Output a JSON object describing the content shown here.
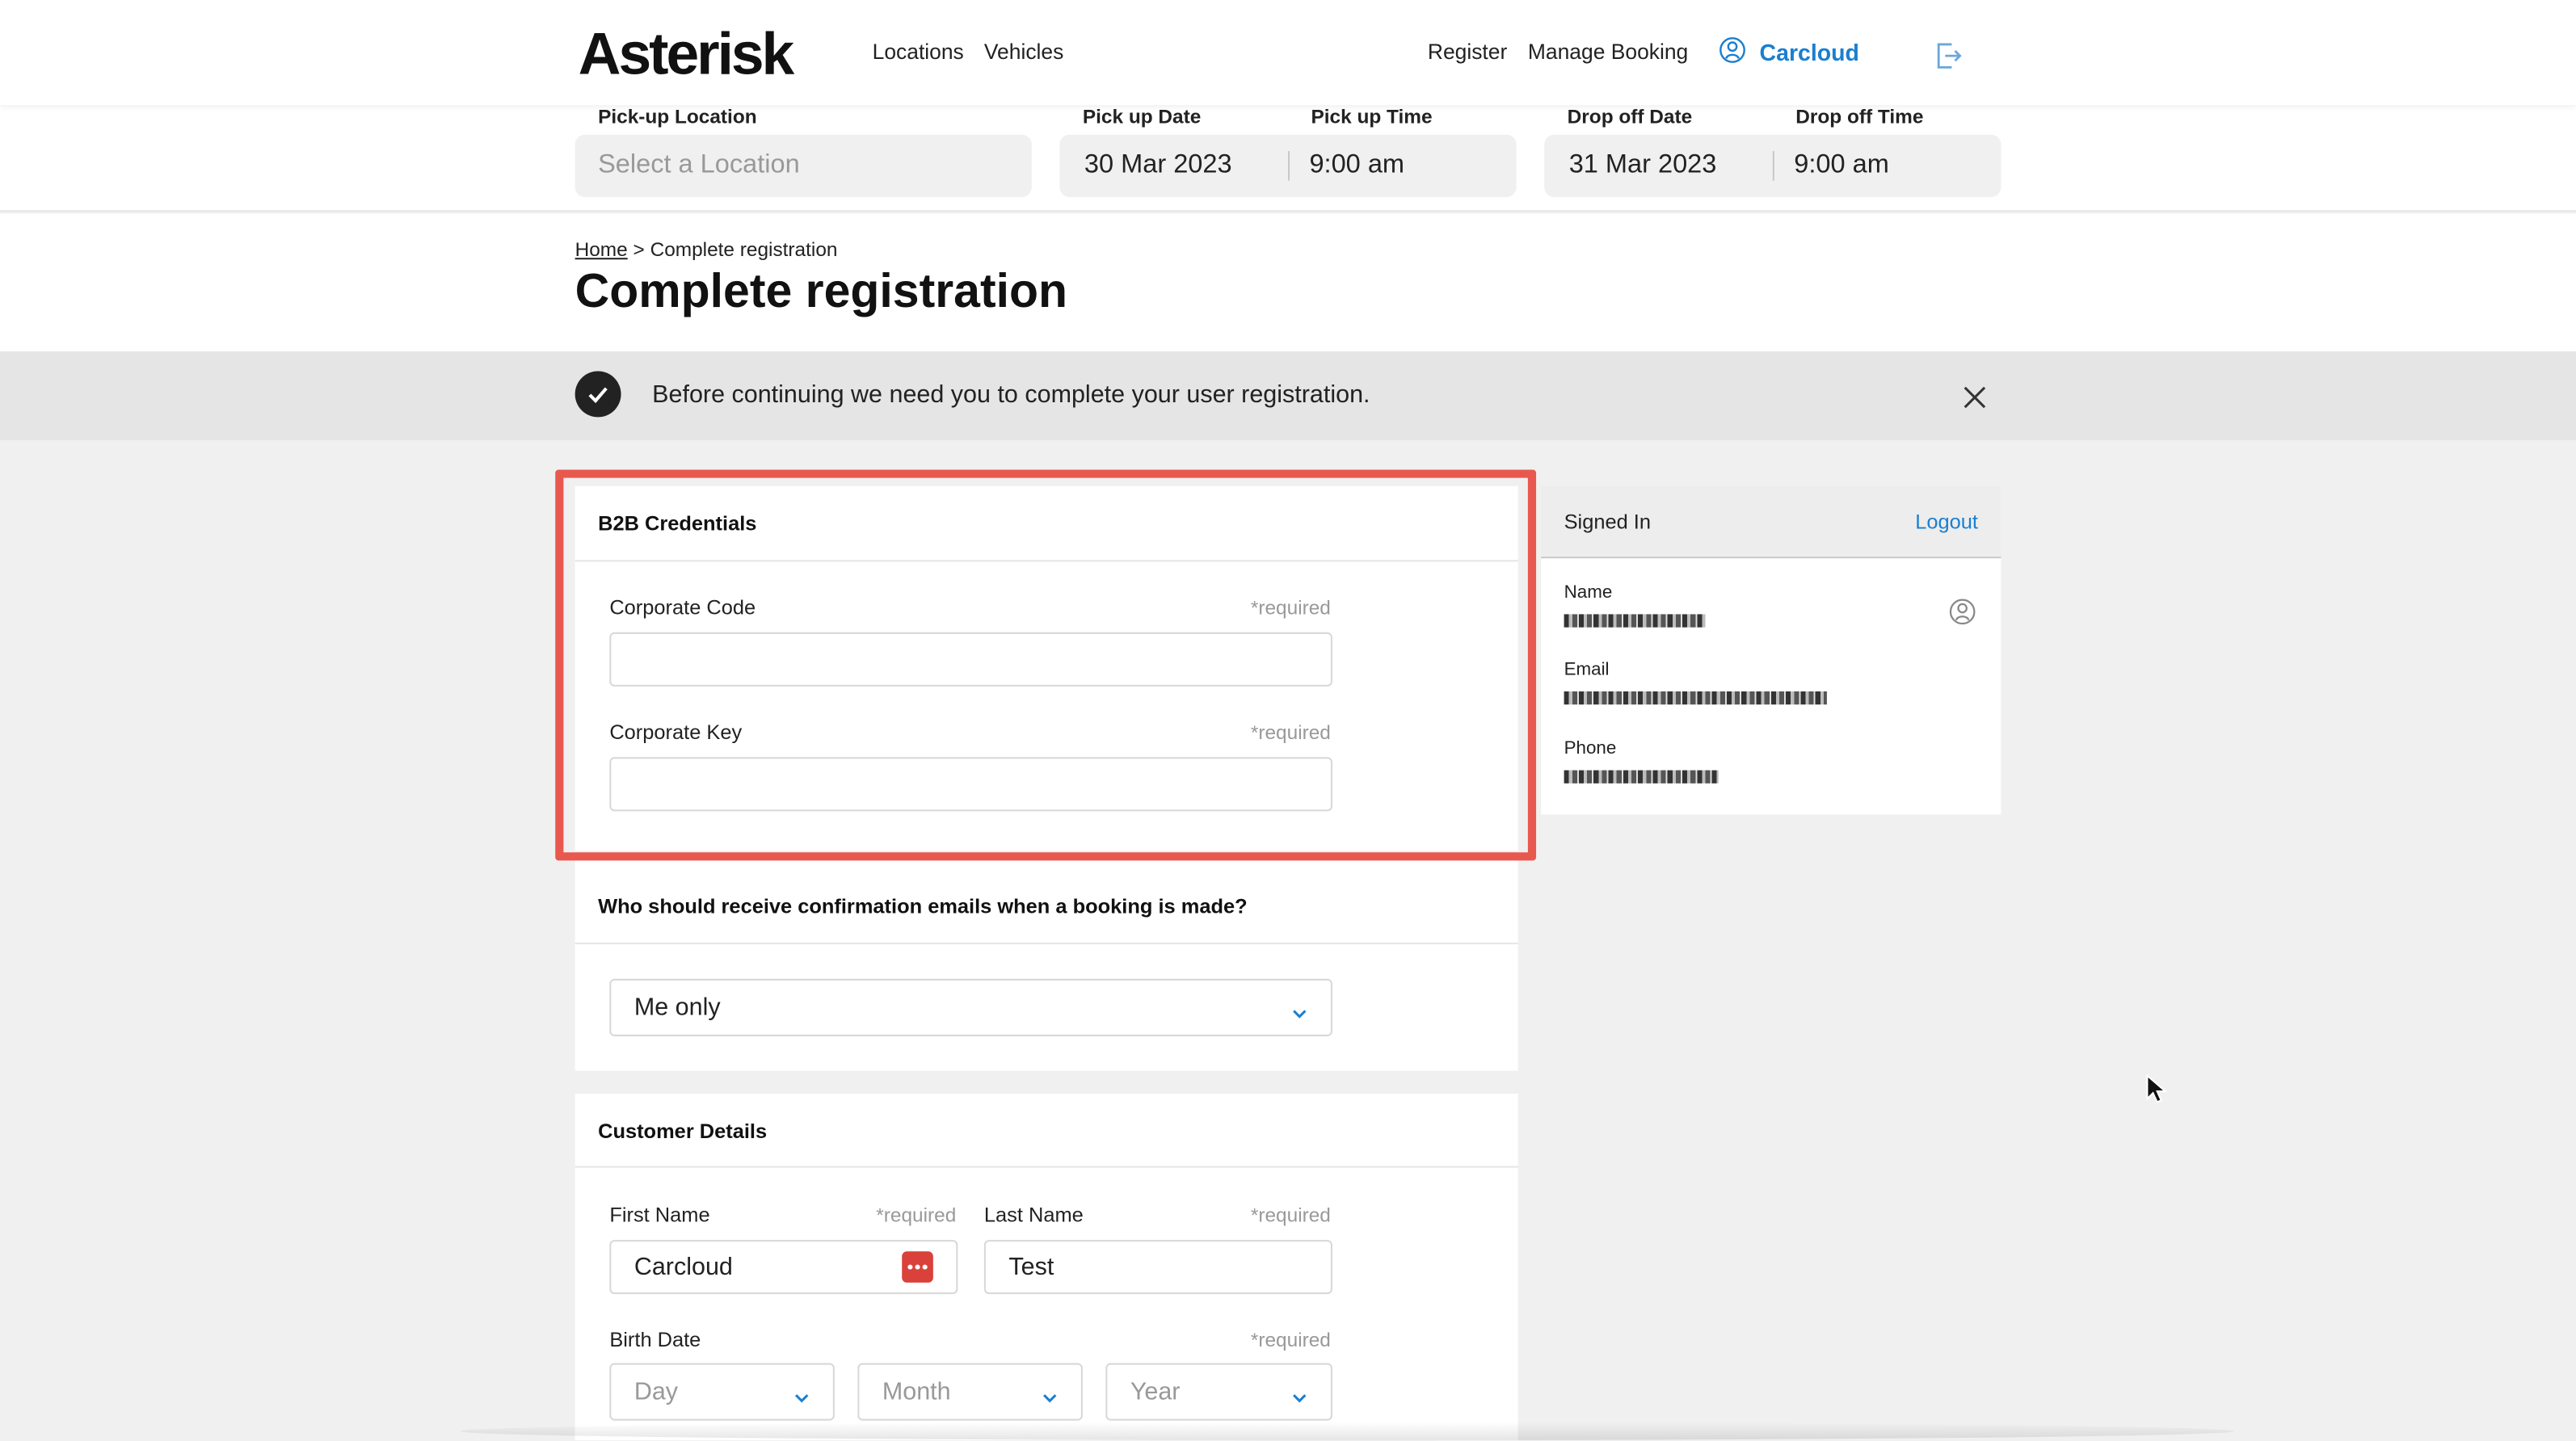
{
  "header": {
    "logo": "Asterisk",
    "nav": [
      "Locations",
      "Vehicles"
    ],
    "register": "Register",
    "manage_booking": "Manage Booking",
    "account_name": "Carcloud",
    "account_icon": "user-circle-icon",
    "logout_icon": "logout-icon"
  },
  "search": {
    "pickup_location_label": "Pick-up Location",
    "pickup_location_placeholder": "Select a Location",
    "pickup_date_label": "Pick up Date",
    "pickup_date": "30 Mar 2023",
    "pickup_time_label": "Pick up Time",
    "pickup_time": "9:00 am",
    "dropoff_date_label": "Drop off Date",
    "dropoff_date": "31 Mar 2023",
    "dropoff_time_label": "Drop off Time",
    "dropoff_time": "9:00 am"
  },
  "breadcrumb": {
    "home": "Home",
    "separator": ">",
    "current": "Complete registration"
  },
  "page_title": "Complete registration",
  "notice": {
    "text": "Before continuing we need you to complete your user registration.",
    "icon": "check-circle-icon",
    "close_icon": "close-icon"
  },
  "b2b": {
    "title": "B2B Credentials",
    "corporate_code_label": "Corporate Code",
    "corporate_code_value": "",
    "corporate_key_label": "Corporate Key",
    "corporate_key_value": "",
    "required": "*required"
  },
  "confirmation": {
    "title": "Who should receive confirmation emails when a booking is made?",
    "selected": "Me only"
  },
  "customer": {
    "title": "Customer Details",
    "first_name_label": "First Name",
    "first_name_value": "Carcloud",
    "last_name_label": "Last Name",
    "last_name_value": "Test",
    "birth_date_label": "Birth Date",
    "day_placeholder": "Day",
    "month_placeholder": "Month",
    "year_placeholder": "Year",
    "required": "*required"
  },
  "signed_in": {
    "title": "Signed In",
    "logout": "Logout",
    "name_label": "Name",
    "email_label": "Email",
    "phone_label": "Phone"
  },
  "colors": {
    "accent": "#1a7fd0",
    "highlight": "#e8584f",
    "autofill_badge": "#d9413a"
  }
}
